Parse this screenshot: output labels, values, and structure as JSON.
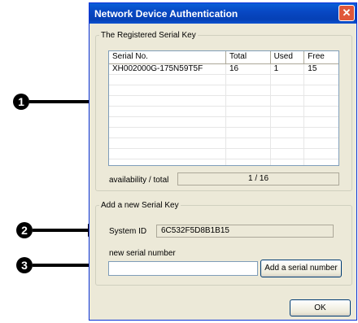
{
  "window": {
    "title": "Network Device Authentication",
    "close_glyph": "✕"
  },
  "registered_group": {
    "legend": "The Registered Serial Key",
    "columns": [
      "Serial No.",
      "Total",
      "Used",
      "Free"
    ],
    "rows": [
      {
        "serial": "XH002000G-175N59T5F",
        "total": "16",
        "used": "1",
        "free": "15"
      }
    ],
    "availability_label": "availability / total",
    "availability_value": "1 / 16"
  },
  "add_group": {
    "legend": "Add a new Serial Key",
    "system_id_label": "System ID",
    "system_id_value": "6C532F5D8B1B15",
    "new_serial_label": "new serial number",
    "new_serial_value": "",
    "add_button_label": "Add a serial number"
  },
  "ok_button_label": "OK",
  "callouts": [
    "1",
    "2",
    "3"
  ]
}
